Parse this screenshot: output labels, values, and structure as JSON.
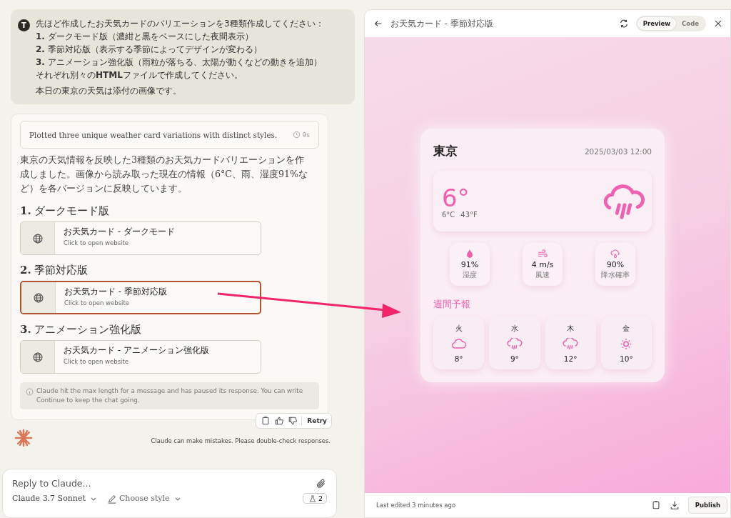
{
  "user_message": {
    "avatar": "T",
    "lines": [
      "先ほど作成したお天気カードのバリエーションを3種類作成してください：",
      "**1.** ダークモード版（濃紺と黒をベースにした夜間表示）",
      "**2.** 季節対応版（表示する季節によってデザインが変わる）",
      "**3.** アニメーション強化版（雨粒が落ちる、太陽が動くなどの動きを追加）",
      "それぞれ別々の**HTML**ファイルで作成してください。"
    ],
    "note": "本日の東京の天気は添付の画像です。"
  },
  "response": {
    "thinking": {
      "summary": "Plotted three unique weather card variations with distinct styles.",
      "duration": "9s"
    },
    "paragraph": "東京の天気情報を反映した3種類のお天気カードバリエーションを作成しました。画像から読み取った現在の情報（6°C、雨、湿度91%など）を各バージョンに反映しています。",
    "sections": [
      {
        "heading": "**1.** ダークモード版",
        "artifact": {
          "title": "お天気カード - ダークモード",
          "subtitle": "Click to open website",
          "selected": false
        }
      },
      {
        "heading": "**2.** 季節対応版",
        "artifact": {
          "title": "お天気カード - 季節対応版",
          "subtitle": "Click to open website",
          "selected": true
        }
      },
      {
        "heading": "**3.** アニメーション強化版",
        "artifact": {
          "title": "お天気カード - アニメーション強化版",
          "subtitle": "Click to open website",
          "selected": false
        }
      }
    ],
    "notice": "Claude hit the max length for a message and has paused its response. You can write Continue to keep the chat going.",
    "retry": "Retry",
    "disclaimer": "Claude can make mistakes. Please double-check responses."
  },
  "composer": {
    "placeholder": "Reply to Claude...",
    "model": "Claude 3.7 Sonnet",
    "style": "Choose style",
    "count": "2"
  },
  "artifact_panel": {
    "title": "お天気カード - 季節対応版",
    "tabs": [
      {
        "label": "Preview",
        "selected": true
      },
      {
        "label": "Code",
        "selected": false
      }
    ],
    "weather": {
      "city": "東京",
      "date": "2025/03/03 12:00",
      "temp": "6°",
      "temp_c": "6°C",
      "temp_f": "43°F",
      "stats": [
        {
          "kind": "humidity",
          "value": "91%",
          "label": "湿度"
        },
        {
          "kind": "wind",
          "value": "4 m/s",
          "label": "風速"
        },
        {
          "kind": "rain",
          "value": "90%",
          "label": "降水確率"
        }
      ],
      "forecast_title": "週間予報",
      "forecast": [
        {
          "day": "火",
          "kind": "cloud",
          "temp": "8°"
        },
        {
          "day": "水",
          "kind": "rain",
          "temp": "9°"
        },
        {
          "day": "木",
          "kind": "rain",
          "temp": "12°"
        },
        {
          "day": "金",
          "kind": "sun",
          "temp": "10°"
        }
      ]
    },
    "status": "Last edited 3 minutes ago",
    "publish": "Publish"
  }
}
